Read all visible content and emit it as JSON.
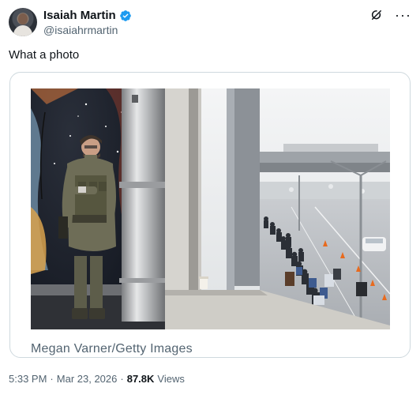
{
  "author": {
    "display_name": "Isaiah Martin",
    "handle": "@isaiahrmartin"
  },
  "tweet": {
    "text": "What a photo"
  },
  "media": {
    "credit": "Megan Varner/Getty Images"
  },
  "meta": {
    "time": "5:33 PM",
    "sep1": "·",
    "date": "Mar 23, 2026",
    "sep2": "·",
    "views_count": "87.8K",
    "views_label": "Views"
  },
  "colors": {
    "verified": "#1d9bf0",
    "secondary_text": "#536471",
    "primary_text": "#0f1419",
    "border": "#cfd9de"
  },
  "icons": {
    "verified": "verified-badge-icon",
    "grok": "grok-icon",
    "more": "more-dots-icon"
  }
}
